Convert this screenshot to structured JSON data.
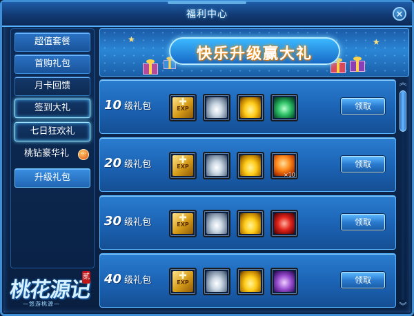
{
  "window": {
    "title": "福利中心",
    "close_label": "✕"
  },
  "sidebar": {
    "items": [
      {
        "label": "超值套餐"
      },
      {
        "label": "首购礼包"
      },
      {
        "label": "月卡回馈"
      },
      {
        "label": "签到大礼"
      },
      {
        "label": "七日狂欢礼"
      },
      {
        "label": "桃钻豪华礼",
        "badge": "⋯"
      },
      {
        "label": "升级礼包"
      }
    ]
  },
  "logo": {
    "text": "桃花源记",
    "mark": "贰",
    "subtitle": "—悠游桃源—"
  },
  "banner": {
    "title": "快乐升级赢大礼"
  },
  "rows": [
    {
      "level_num": "10",
      "level_suffix": "级礼包",
      "button": "领取",
      "items": [
        {
          "icon": "exp-scroll-icon",
          "label": "EXP"
        },
        {
          "icon": "silver-ingot-icon"
        },
        {
          "icon": "gold-ingot-icon"
        },
        {
          "icon": "green-pot-icon"
        }
      ]
    },
    {
      "level_num": "20",
      "level_suffix": "级礼包",
      "button": "领取",
      "items": [
        {
          "icon": "exp-scroll-icon",
          "label": "EXP"
        },
        {
          "icon": "silver-ingot-icon"
        },
        {
          "icon": "gold-ingot-icon"
        },
        {
          "icon": "fire-orb-icon",
          "count": "×10"
        }
      ]
    },
    {
      "level_num": "30",
      "level_suffix": "级礼包",
      "button": "领取",
      "items": [
        {
          "icon": "exp-scroll-icon",
          "label": "EXP"
        },
        {
          "icon": "silver-ingot-icon"
        },
        {
          "icon": "gold-ingot-icon"
        },
        {
          "icon": "red-gift-box-icon"
        }
      ]
    },
    {
      "level_num": "40",
      "level_suffix": "级礼包",
      "button": "领取",
      "items": [
        {
          "icon": "exp-scroll-icon",
          "label": "EXP"
        },
        {
          "icon": "silver-ingot-icon"
        },
        {
          "icon": "gold-ingot-icon"
        },
        {
          "icon": "purple-chest-icon"
        }
      ]
    }
  ],
  "scrollbar": {
    "up": "︽",
    "down": "︾"
  }
}
